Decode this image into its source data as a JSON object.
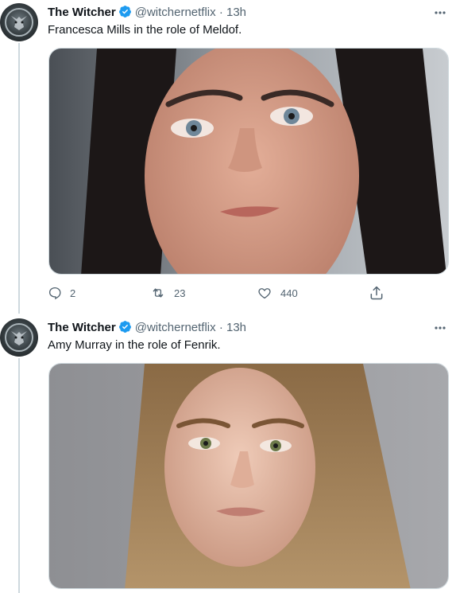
{
  "tweets": [
    {
      "author_name": "The Witcher",
      "handle": "@witchernetflix",
      "separator": "·",
      "time": "13h",
      "text": "Francesca Mills in the role of Meldof.",
      "replies": "2",
      "retweets": "23",
      "likes": "440"
    },
    {
      "author_name": "The Witcher",
      "handle": "@witchernetflix",
      "separator": "·",
      "time": "13h",
      "text": "Amy Murray in the role of Fenrik."
    }
  ],
  "colors": {
    "verified": "#1d9bf0",
    "secondary_text": "#536471",
    "thread_line": "#cfd9de"
  },
  "icons": {
    "reply": "reply-icon",
    "retweet": "retweet-icon",
    "like": "heart-icon",
    "share": "share-icon",
    "more": "more-icon",
    "verified": "verified-badge-icon"
  }
}
